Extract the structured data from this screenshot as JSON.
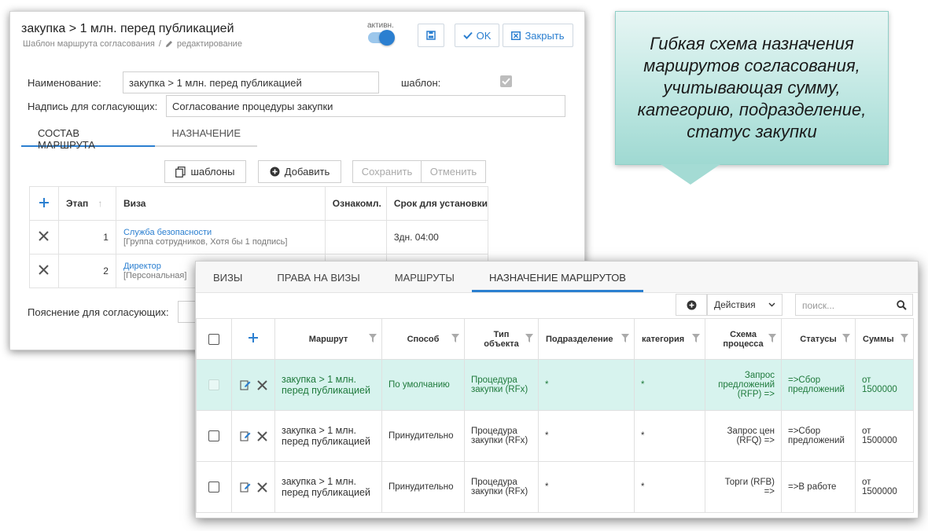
{
  "editor": {
    "title": "закупка > 1 млн. перед публикацией",
    "breadcrumb_parent": "Шаблон маршрута согласования",
    "breadcrumb_sep": "/",
    "breadcrumb_current": "редактирование",
    "active_label": "активн.",
    "ok_label": "OK",
    "close_label": "Закрыть",
    "name_label": "Наименование:",
    "name_value": "закупка > 1 млн. перед публикацией",
    "template_label": "шаблон:",
    "caption_label": "Надпись для согласующих:",
    "caption_value": "Согласование процедуры закупки",
    "tabs": [
      "СОСТАВ МАРШРУТА",
      "НАЗНАЧЕНИЕ"
    ],
    "templates_btn": "шаблоны",
    "add_btn": "Добавить",
    "save_btn": "Сохранить",
    "cancel_btn": "Отменить",
    "table": {
      "headers": [
        "Этап",
        "Виза",
        "Ознакомл.",
        "Срок для установки"
      ],
      "rows": [
        {
          "stage": "1",
          "visa": "Служба безопасности",
          "visa_sub": "[Группа сотрудников, Хотя бы 1 подпись]",
          "term": "3дн. 04:00"
        },
        {
          "stage": "2",
          "visa": "Директор",
          "visa_sub": "[Персональная]",
          "term": ""
        }
      ]
    },
    "hint_label": "Пояснение для согласующих:"
  },
  "callout": {
    "text": "Гибкая схема назначения маршрутов согласования, учитывающая сумму, категорию, подразделение, статус закупки"
  },
  "assign": {
    "tabs": [
      "ВИЗЫ",
      "ПРАВА НА ВИЗЫ",
      "МАРШРУТЫ",
      "НАЗНАЧЕНИЕ МАРШРУТОВ"
    ],
    "actions_label": "Действия",
    "search_placeholder": "поиск...",
    "headers": [
      "Маршрут",
      "Способ",
      "Тип объекта",
      "Подразделение",
      "категория",
      "Схема процесса",
      "Статусы",
      "Суммы"
    ],
    "rows": [
      {
        "route": "закупка > 1 млн. перед публикацией",
        "method": "По умолчанию",
        "object": "Процедура закупки (RFx)",
        "dept": "*",
        "category": "*",
        "scheme": "Запрос предложений (RFP) =>",
        "statuses": "=>Сбор предложений",
        "sums": "от 1500000"
      },
      {
        "route": "закупка > 1 млн. перед публикацией",
        "method": "Принудительно",
        "object": "Процедура закупки (RFx)",
        "dept": "*",
        "category": "*",
        "scheme": "Запрос цен (RFQ) =>",
        "statuses": "=>Сбор предложений",
        "sums": "от 1500000"
      },
      {
        "route": "закупка > 1 млн. перед публикацией",
        "method": "Принудительно",
        "object": "Процедура закупки (RFx)",
        "dept": "*",
        "category": "*",
        "scheme": "Торги (RFB) =>",
        "statuses": "=>В работе",
        "sums": "от 1500000"
      }
    ]
  },
  "colors": {
    "accent": "#2b7fd0",
    "highlight_row": "#d7f3ee",
    "callout": "#bfe7e2"
  }
}
